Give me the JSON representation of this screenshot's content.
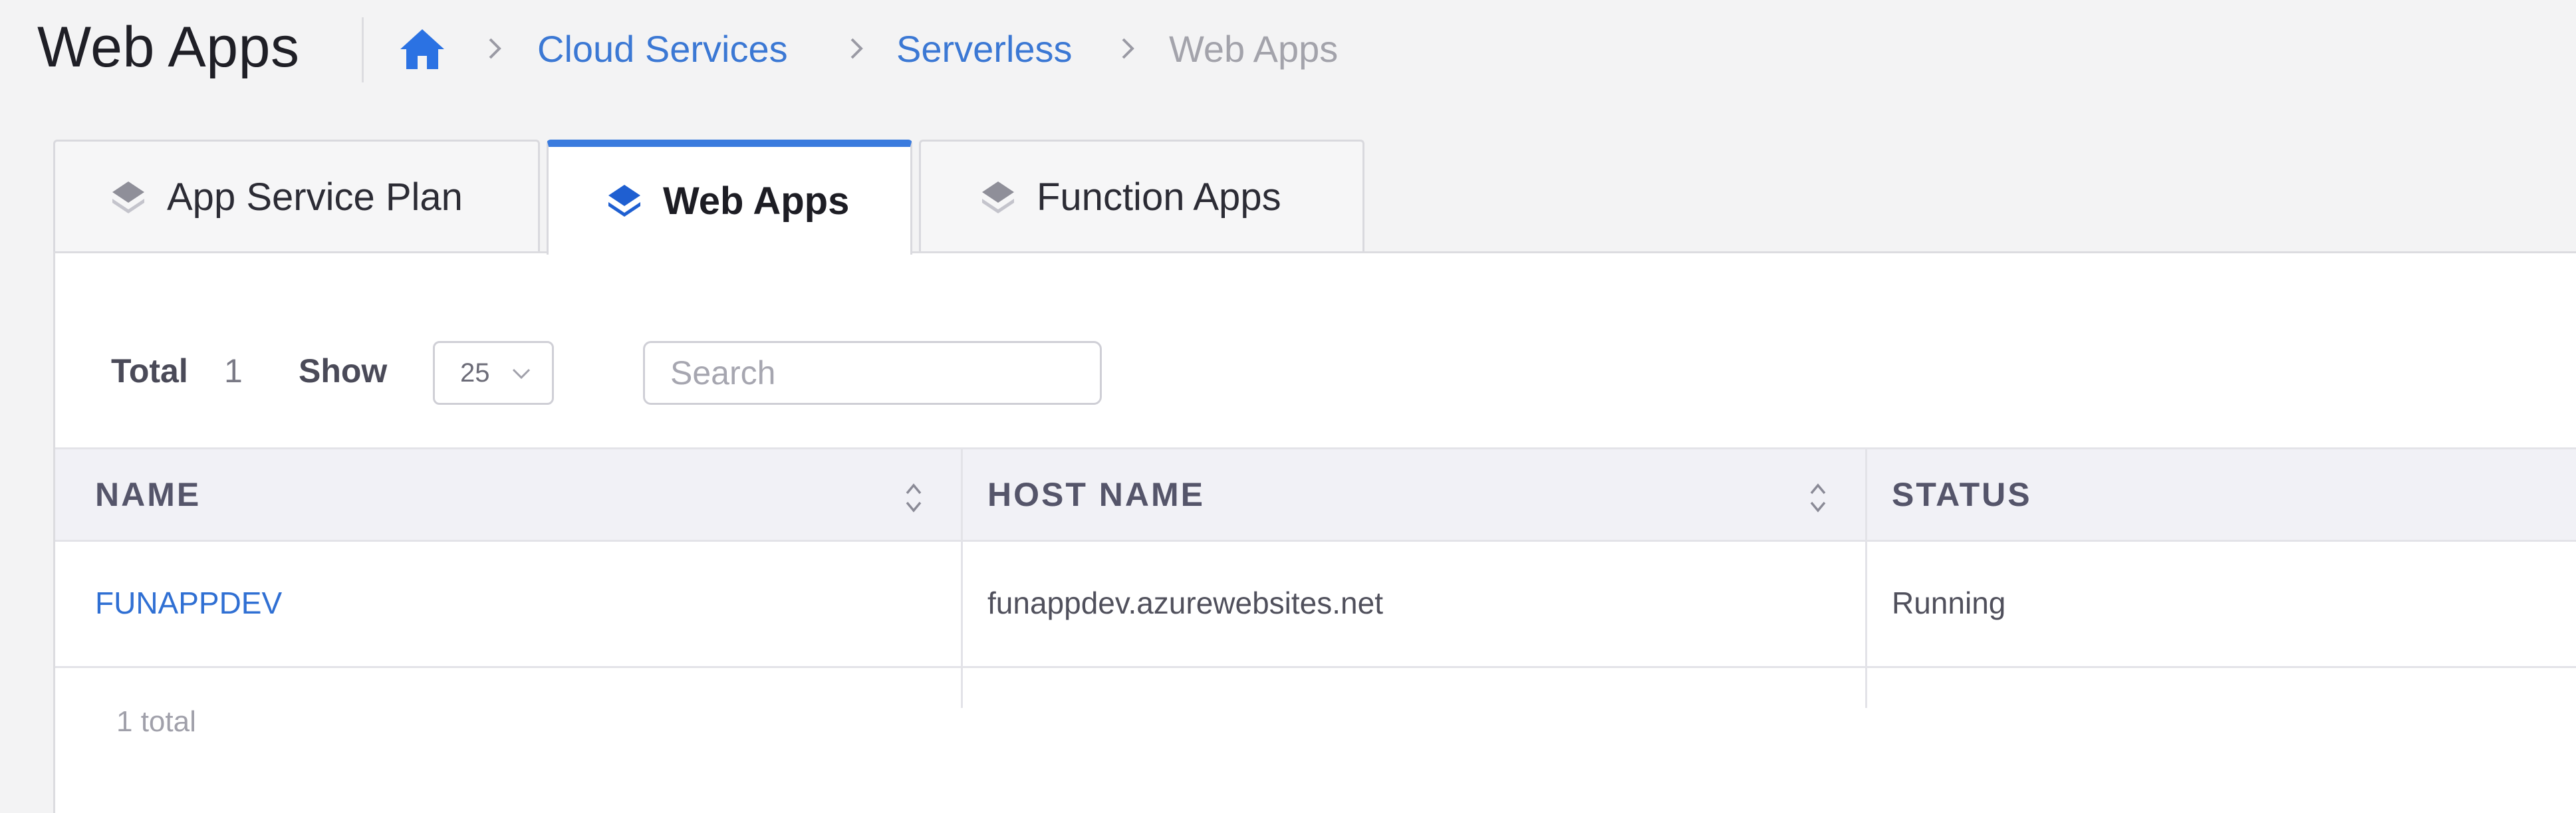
{
  "header": {
    "title": "Web Apps",
    "breadcrumb": [
      {
        "label": "Cloud Services",
        "link": true
      },
      {
        "label": "Serverless",
        "link": true
      },
      {
        "label": "Web Apps",
        "link": false
      }
    ]
  },
  "tabs": [
    {
      "label": "App Service Plan",
      "active": false,
      "icon": "layers-icon"
    },
    {
      "label": "Web Apps",
      "active": true,
      "icon": "layers-icon"
    },
    {
      "label": "Function Apps",
      "active": false,
      "icon": "layers-icon"
    }
  ],
  "toolbar": {
    "total_label": "Total",
    "total_value": "1",
    "show_label": "Show",
    "page_size": "25",
    "search_placeholder": "Search"
  },
  "table": {
    "columns": [
      "NAME",
      "HOST NAME",
      "STATUS"
    ],
    "rows": [
      {
        "name": "FUNAPPDEV",
        "host_name": "funappdev.azurewebsites.net",
        "status": "Running"
      }
    ],
    "footer": "1 total"
  },
  "colors": {
    "accent": "#3a7bde",
    "link": "#2f6fd3",
    "header_bg": "#f1f1f6"
  }
}
